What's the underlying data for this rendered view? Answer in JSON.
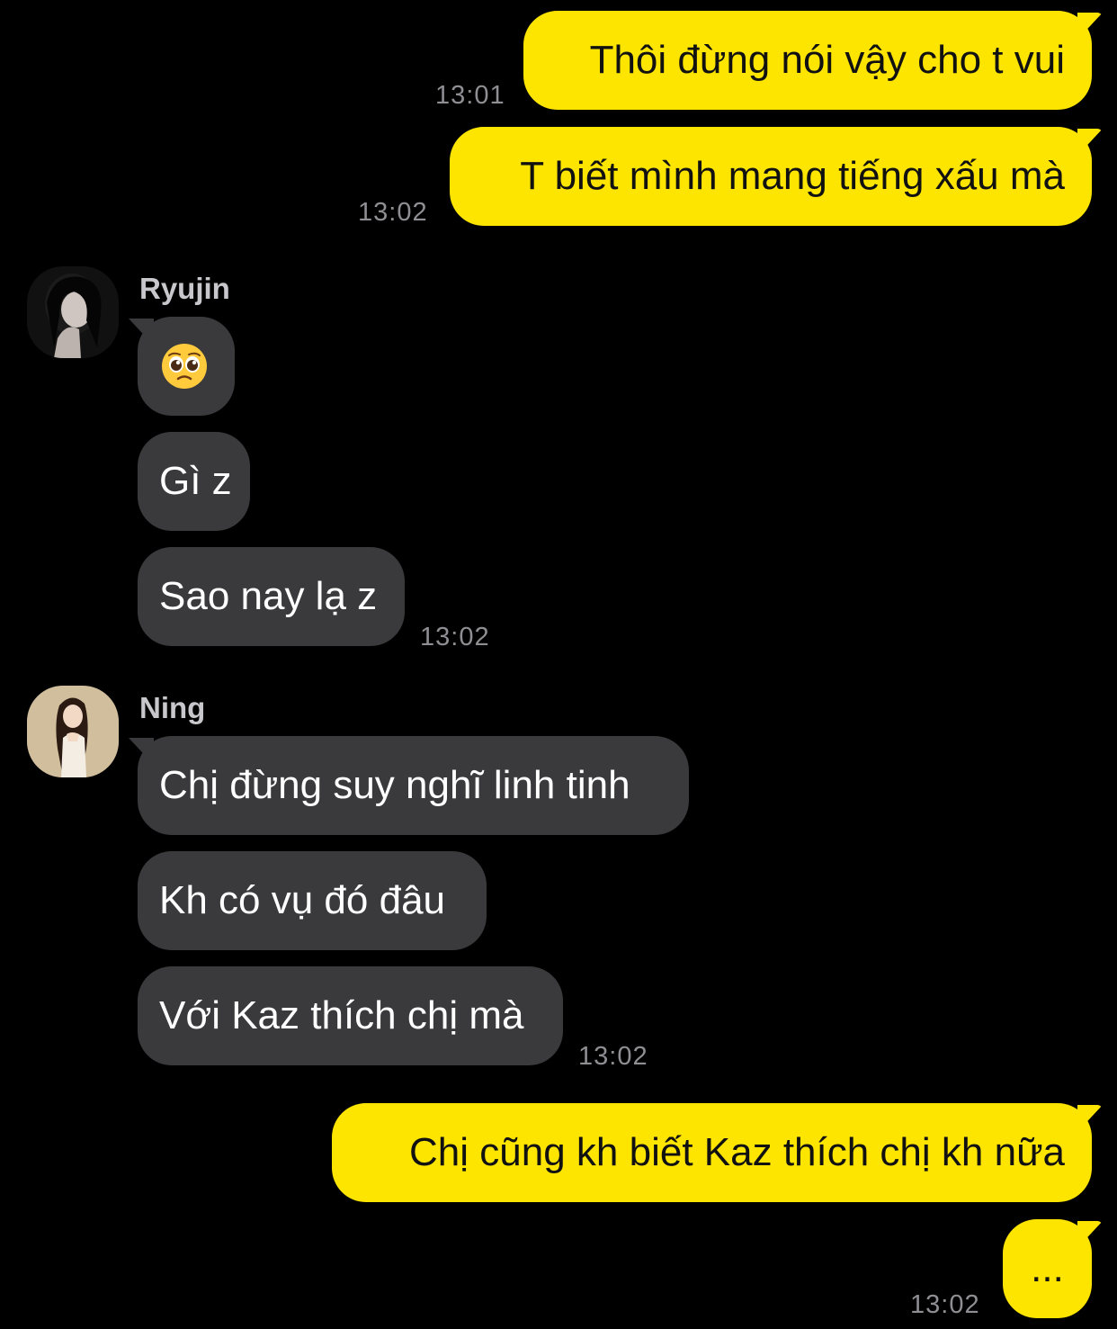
{
  "messages": {
    "m1": {
      "text": "Thôi đừng nói vậy cho t vui",
      "time": "13:01"
    },
    "m2": {
      "text": "T biết mình mang tiếng xấu mà",
      "time": "13:02"
    },
    "ryujin": {
      "name": "Ryujin",
      "avatar_icon": "ryujin-avatar",
      "msg1_emoji": "pleading-face-icon",
      "msg2": "Gì z",
      "msg3": "Sao nay lạ z",
      "time": "13:02"
    },
    "ning": {
      "name": "Ning",
      "avatar_icon": "ning-avatar",
      "msg1": "Chị đừng suy nghĩ linh tinh",
      "msg2": "Kh có vụ đó đâu",
      "msg3": "Với Kaz thích chị mà",
      "time": "13:02"
    },
    "m3": {
      "text": "Chị cũng kh biết Kaz thích chị kh nữa"
    },
    "m4": {
      "text": "...",
      "time": "13:02"
    }
  },
  "colors": {
    "outgoing_bubble": "#FDE500",
    "incoming_bubble": "#3a3a3c",
    "background": "#000000",
    "timestamp": "#8e8e93"
  }
}
